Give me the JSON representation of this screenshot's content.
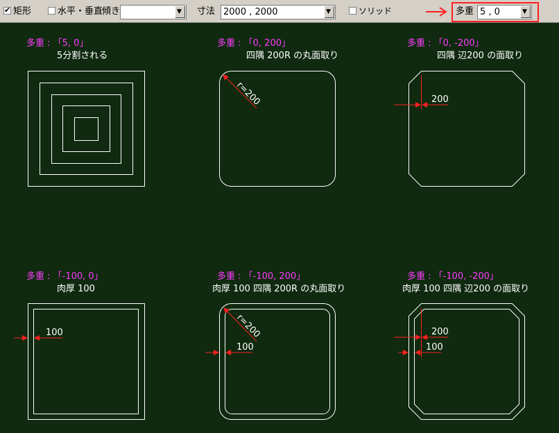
{
  "toolbar": {
    "rect_label": "矩形",
    "rect_checked_mark": "✔",
    "hv_label": "水平・垂直",
    "tilt_label": "傾き",
    "tilt_value": "",
    "size_label": "寸法",
    "size_value": "2000 , 2000",
    "solid_label": "ソリッド",
    "multi_label": "多重",
    "multi_value": "5 , 0",
    "dropdown_glyph": "▼"
  },
  "examples": [
    {
      "code": "多重 : 「5, 0」",
      "desc": "5分割される"
    },
    {
      "code": "多重 : 「0, 200」",
      "desc": "四隅 200R の丸面取り"
    },
    {
      "code": "多重 : 「0, -200」",
      "desc": "四隅 辺200 の面取り"
    },
    {
      "code": "多重 : 「-100, 0」",
      "desc": "肉厚 100"
    },
    {
      "code": "多重 : 「-100, 200」",
      "desc": "肉厚 100 四隅 200R の丸面取り"
    },
    {
      "code": "多重 : 「-100, -200」",
      "desc": "肉厚 100 四隅 辺200 の面取り"
    }
  ],
  "dimensions": {
    "r200": "r=200",
    "d200": "200",
    "d100": "100"
  },
  "colors": {
    "background": "#0f2a0f",
    "shape": "#ffffff",
    "code_text": "#ff3cff",
    "dimension": "#ff2020",
    "highlight": "#ff2020"
  }
}
